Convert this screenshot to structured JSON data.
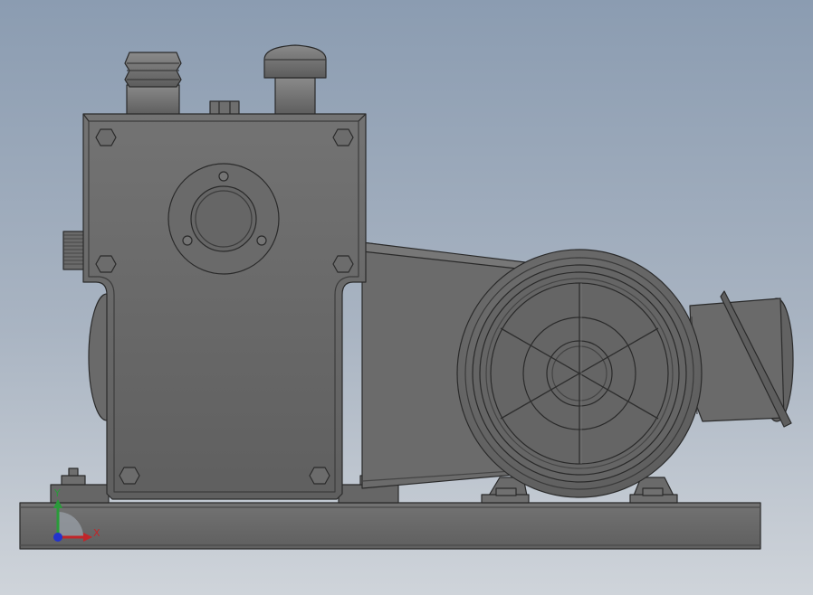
{
  "viewport": {
    "background_top": "#8b9cb1",
    "background_bottom": "#cfd4da",
    "part_color": "#686868",
    "edge_color": "#2a2a2a"
  },
  "triad": {
    "x_label": "X",
    "y_label": "Y",
    "x_color": "#c0262a",
    "y_color": "#2a9a3a",
    "z_color": "#2233cc"
  }
}
